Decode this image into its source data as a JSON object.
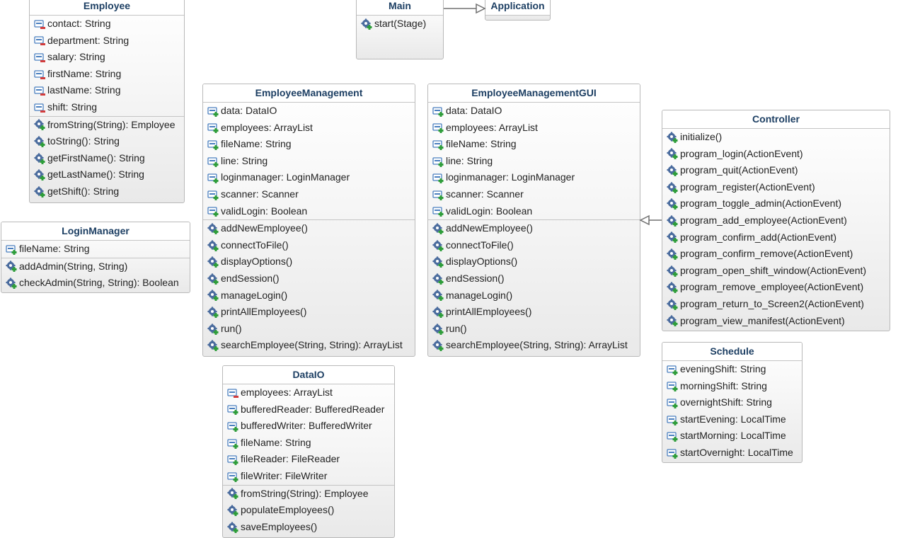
{
  "colors": {
    "class_name": "#1d3f63",
    "border": "#b9b9b9",
    "field_icon": "#4a7fbf",
    "public_marker": "#2e9d3a",
    "private_marker": "#d23c3c",
    "method_icon": "#4b6c9e"
  },
  "classes": {
    "employee": {
      "name": "Employee",
      "fields": [
        "contact: String",
        "department: String",
        "salary: String",
        "firstName: String",
        "lastName: String",
        "shift: String"
      ],
      "methods": [
        "fromString(String): Employee",
        "toString(): String",
        "getFirstName(): String",
        "getLastName(): String",
        "getShift(): String"
      ]
    },
    "main": {
      "name": "Main",
      "methods": [
        "start(Stage)"
      ]
    },
    "application": {
      "name": "Application"
    },
    "login_manager": {
      "name": "LoginManager",
      "fields": [
        "fileName: String"
      ],
      "methods": [
        "addAdmin(String, String)",
        "checkAdmin(String, String): Boolean"
      ]
    },
    "employee_management": {
      "name": "EmployeeManagement",
      "fields": [
        "data: DataIO",
        "employees: ArrayList",
        "fileName: String",
        "line: String",
        "loginmanager: LoginManager",
        "scanner: Scanner",
        "validLogin: Boolean"
      ],
      "methods": [
        "addNewEmployee()",
        "connectToFile()",
        "displayOptions()",
        "endSession()",
        "manageLogin()",
        "printAllEmployees()",
        "run()",
        "searchEmployee(String, String): ArrayList"
      ]
    },
    "employee_management_gui": {
      "name": "EmployeeManagementGUI",
      "fields": [
        "data: DataIO",
        "employees: ArrayList",
        "fileName: String",
        "line: String",
        "loginmanager: LoginManager",
        "scanner: Scanner",
        "validLogin: Boolean"
      ],
      "methods": [
        "addNewEmployee()",
        "connectToFile()",
        "displayOptions()",
        "endSession()",
        "manageLogin()",
        "printAllEmployees()",
        "run()",
        "searchEmployee(String, String): ArrayList"
      ]
    },
    "controller": {
      "name": "Controller",
      "methods": [
        "initialize()",
        "program_login(ActionEvent)",
        "program_quit(ActionEvent)",
        "program_register(ActionEvent)",
        "program_toggle_admin(ActionEvent)",
        "program_add_employee(ActionEvent)",
        "program_confirm_add(ActionEvent)",
        "program_confirm_remove(ActionEvent)",
        "program_open_shift_window(ActionEvent)",
        "program_remove_employee(ActionEvent)",
        "program_return_to_Screen2(ActionEvent)",
        "program_view_manifest(ActionEvent)"
      ]
    },
    "data_io": {
      "name": "DataIO",
      "fields": [
        "employees: ArrayList",
        "bufferedReader: BufferedReader",
        "bufferedWriter: BufferedWriter",
        "fileName: String",
        "fileReader: FileReader",
        "fileWriter: FileWriter"
      ],
      "methods": [
        "fromString(String): Employee",
        "populateEmployees()",
        "saveEmployees()"
      ]
    },
    "schedule": {
      "name": "Schedule",
      "fields": [
        "eveningShift: String",
        "morningShift: String",
        "overnightShift: String",
        "startEvening: LocalTime",
        "startMorning: LocalTime",
        "startOvernight: LocalTime"
      ]
    }
  }
}
